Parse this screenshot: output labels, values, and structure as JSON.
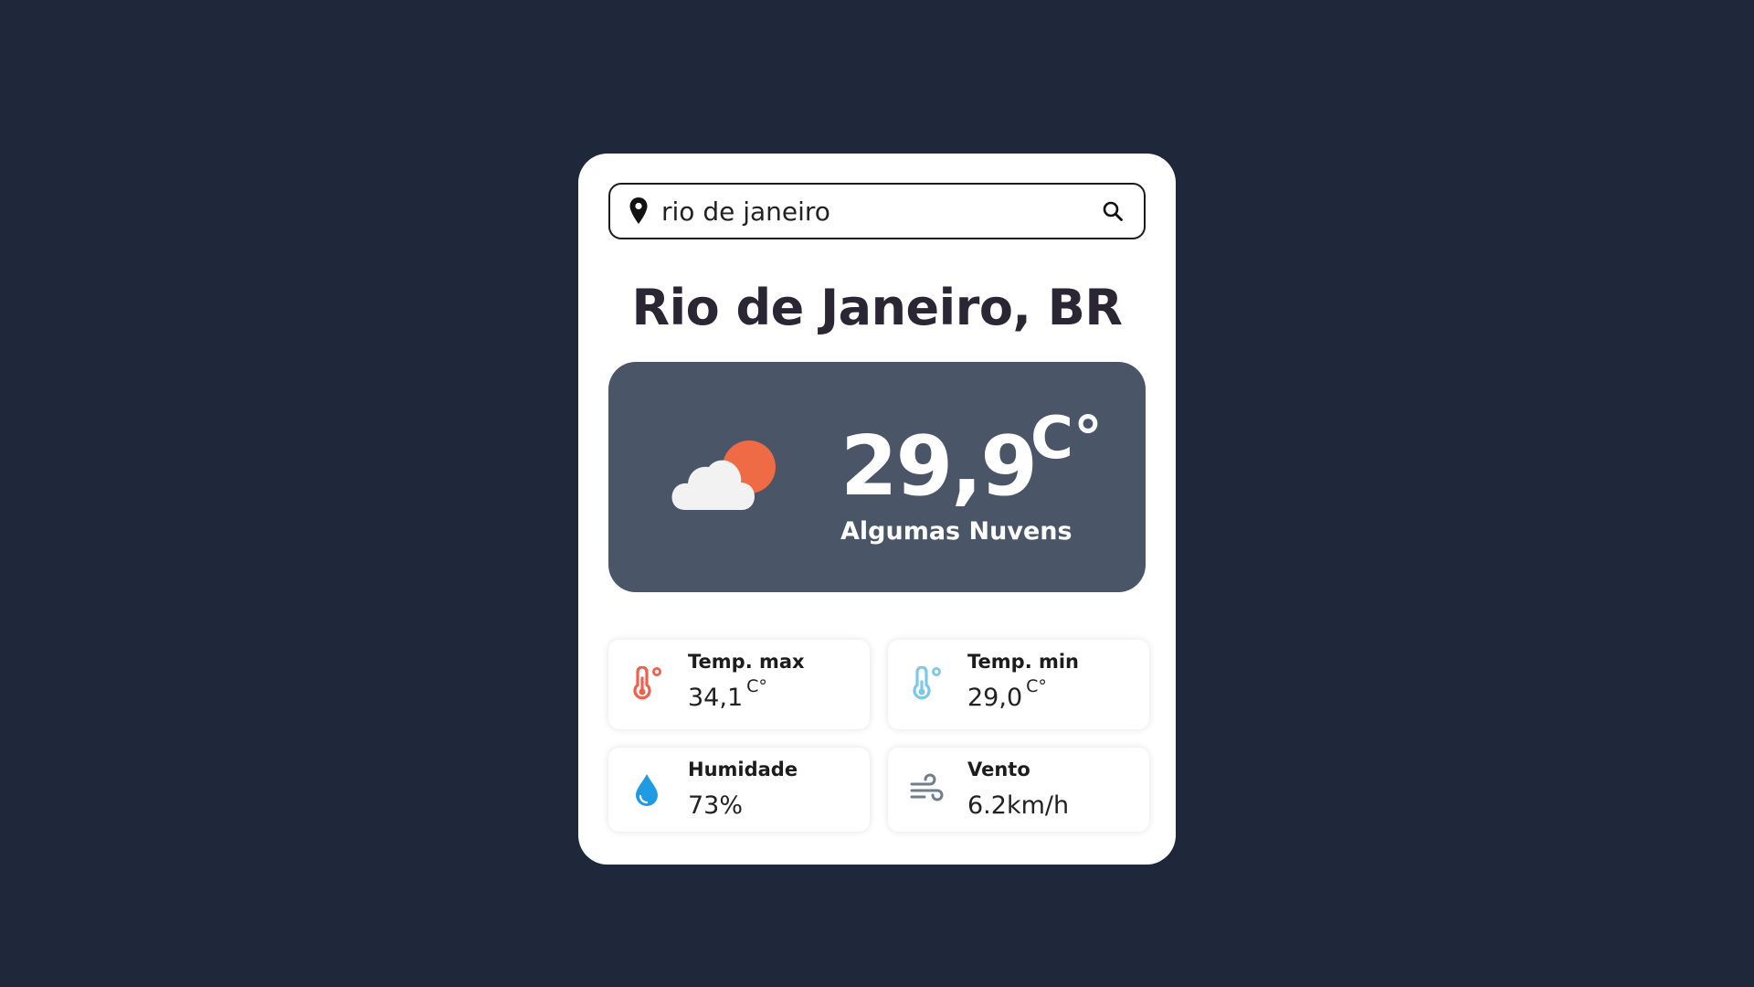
{
  "search": {
    "value": "rio de janeiro",
    "pin_icon": "map-pin-icon",
    "search_icon": "search-icon"
  },
  "weather": {
    "city": "Rio de Janeiro, BR",
    "temperature": "29,9",
    "unit": "C°",
    "description": "Algumas Nuvens",
    "icon": "cloud-sun-icon"
  },
  "details": {
    "max": {
      "label": "Temp. max",
      "value": "34,1",
      "unit": "C°",
      "icon": "thermometer-hot-icon"
    },
    "min": {
      "label": "Temp. min",
      "value": "29,0",
      "unit": "C°",
      "icon": "thermometer-cold-icon"
    },
    "humidity": {
      "label": "Humidade",
      "value": "73%",
      "icon": "water-drop-icon"
    },
    "wind": {
      "label": "Vento",
      "value": "6.2km/h",
      "icon": "wind-icon"
    }
  },
  "colors": {
    "background": "#1f283b",
    "card": "#ffffff",
    "main_box": "#4a5568",
    "sun": "#ee6b46",
    "cloud": "#f2f2f2",
    "hot": "#f0604d",
    "cold": "#7cc8ec",
    "drop": "#1e9be2",
    "wind": "#6f7d90"
  }
}
